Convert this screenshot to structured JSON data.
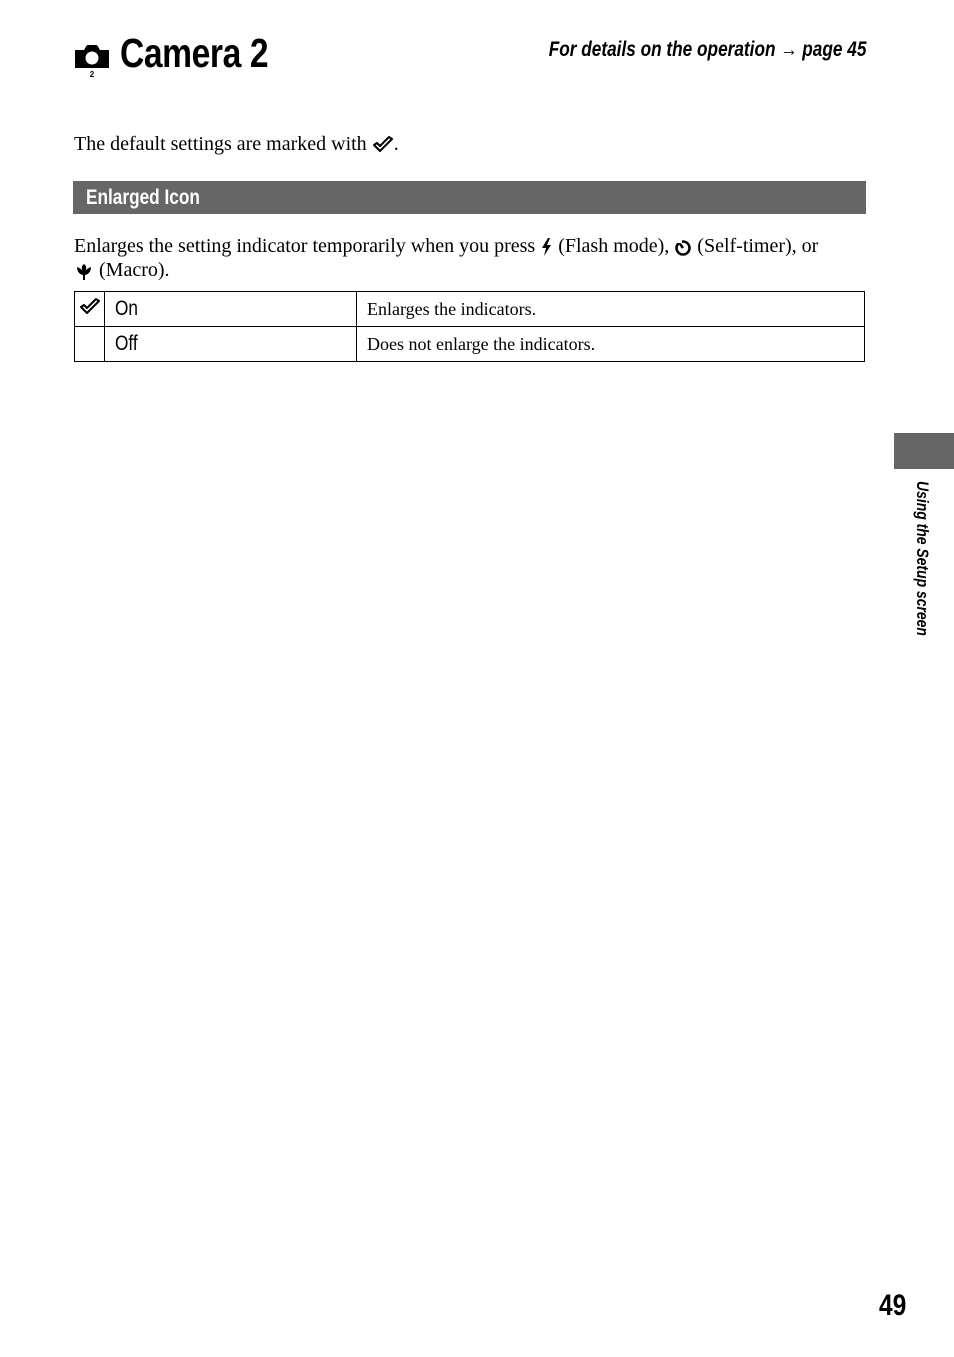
{
  "header": {
    "title": "Camera 2",
    "camera_icon_subscript": "2",
    "details_ref": "For details on the operation →  page 45"
  },
  "intro": {
    "text_before_icon": "The default settings are marked with ",
    "text_after_icon": "."
  },
  "section": {
    "title": "Enlarged Icon",
    "description_parts": {
      "p1": "Enlarges the setting indicator temporarily when you press ",
      "p2": " (Flash mode), ",
      "p3": " (Self-timer), or",
      "p4": " (Macro)."
    },
    "options": [
      {
        "label": "On",
        "description": "Enlarges the indicators.",
        "default": true
      },
      {
        "label": "Off",
        "description": "Does not enlarge the indicators.",
        "default": false
      }
    ]
  },
  "side_tab": {
    "label": "Using the Setup screen"
  },
  "page_number": "49",
  "colors": {
    "section_bar": "#666666",
    "side_tab": "#666666"
  }
}
